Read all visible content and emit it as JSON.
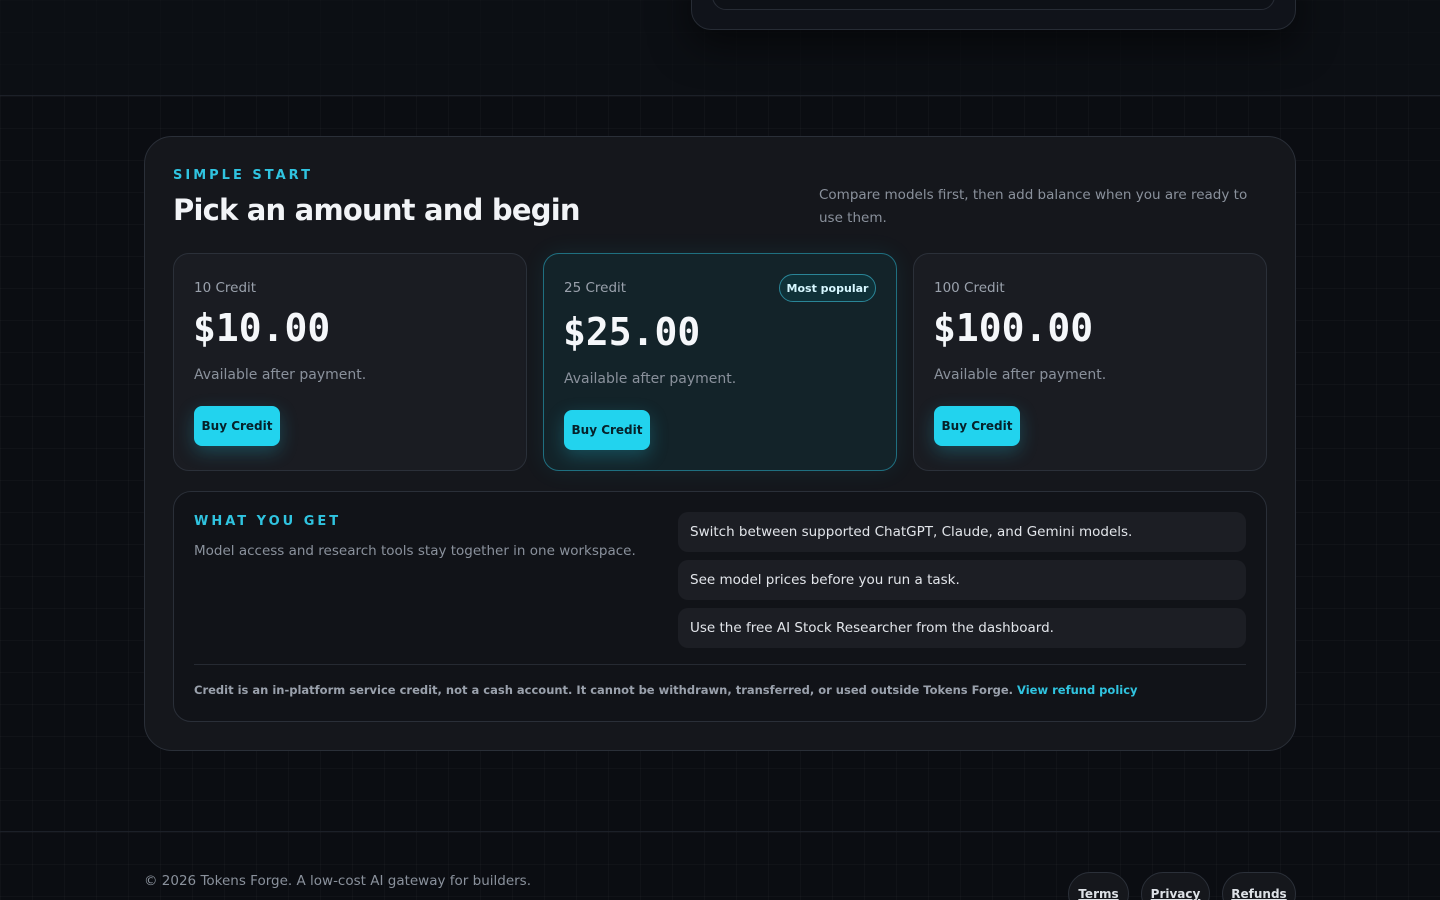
{
  "pricing": {
    "eyebrow": "SIMPLE START",
    "title": "Pick an amount and begin",
    "description": "Compare models first, then add balance when you are ready to use them.",
    "plans": [
      {
        "name": "10 Credit",
        "price": "$10.00",
        "note": "Available after payment.",
        "button": "Buy Credit"
      },
      {
        "name": "25 Credit",
        "price": "$25.00",
        "note": "Available after payment.",
        "button": "Buy Credit",
        "badge": "Most popular"
      },
      {
        "name": "100 Credit",
        "price": "$100.00",
        "note": "Available after payment.",
        "button": "Buy Credit"
      }
    ]
  },
  "benefits": {
    "eyebrow": "WHAT YOU GET",
    "description": "Model access and research tools stay together in one workspace.",
    "items": [
      "Switch between supported ChatGPT, Claude, and Gemini models.",
      "See model prices before you run a task.",
      "Use the free AI Stock Researcher from the dashboard."
    ],
    "disclaimer": "Credit is an in-platform service credit, not a cash account. It cannot be withdrawn, transferred, or used outside Tokens Forge.",
    "refund_link": "View refund policy"
  },
  "footer": {
    "copyright": "© 2026 Tokens Forge. A low-cost AI gateway for builders.",
    "links": [
      "Terms",
      "Privacy",
      "Refunds"
    ]
  },
  "colors": {
    "accent": "#22d3ee",
    "background": "#0b0d12",
    "panel": "#15171c"
  }
}
